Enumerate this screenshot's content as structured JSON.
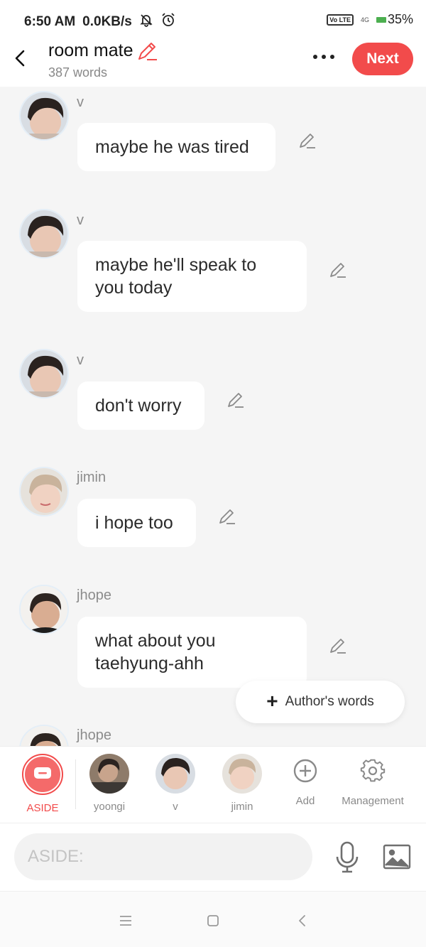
{
  "status_bar": {
    "time": "6:50 AM",
    "speed": "0.0KB/s",
    "volte": "Vo LTE",
    "network": "4G",
    "battery": "35%",
    "icons": [
      "mute-bell-icon",
      "alarm-icon",
      "battery-icon"
    ]
  },
  "header": {
    "title": "room mate",
    "word_count": "387 words",
    "next_label": "Next",
    "accent_color": "#f24b4b"
  },
  "messages": [
    {
      "speaker": "v",
      "text": "maybe he was tired"
    },
    {
      "speaker": "v",
      "text": "maybe he'll speak to you today"
    },
    {
      "speaker": "v",
      "text": "don't worry"
    },
    {
      "speaker": "jimin",
      "text": "i hope too"
    },
    {
      "speaker": "jhope",
      "text": "what about you taehyung-ahh"
    },
    {
      "speaker": "jhope",
      "text": ""
    }
  ],
  "author_words": {
    "label": "Author's words"
  },
  "characters": [
    {
      "name": "ASIDE",
      "active": true
    },
    {
      "name": "yoongi"
    },
    {
      "name": "v"
    },
    {
      "name": "jimin"
    }
  ],
  "tools": {
    "add_label": "Add",
    "management_label": "Management"
  },
  "input": {
    "placeholder": "ASIDE:"
  },
  "nav": {
    "icons": [
      "menu-icon",
      "home-icon",
      "back-icon"
    ]
  }
}
